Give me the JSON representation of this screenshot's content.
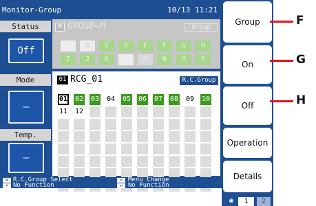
{
  "window": {
    "title": "Monitor-Group",
    "datetime": "10/13 11:21"
  },
  "left": {
    "status_label": "Status",
    "status_value": "Off",
    "mode_label": "Mode",
    "mode_value": "–",
    "temp_label": "Temp.",
    "temp_value": "–"
  },
  "group": {
    "badge": "M",
    "name": "GROUP—M",
    "tag": "Group",
    "cells": [
      {
        "label": "",
        "style": "w"
      },
      {
        "label": "B",
        "style": "w"
      },
      {
        "label": "C",
        "style": "g"
      },
      {
        "label": "D",
        "style": "g"
      },
      {
        "label": "E",
        "style": "g"
      },
      {
        "label": "F",
        "style": "g"
      },
      {
        "label": "G",
        "style": "g"
      },
      {
        "label": "H",
        "style": "g"
      },
      {
        "label": "I",
        "style": "g"
      },
      {
        "label": "J",
        "style": "g"
      },
      {
        "label": "K",
        "style": "g"
      },
      {
        "label": "",
        "style": "w"
      },
      {
        "label": "M",
        "style": "s"
      },
      {
        "label": "N",
        "style": "g"
      },
      {
        "label": "O",
        "style": "g"
      },
      {
        "label": "P",
        "style": "g"
      }
    ]
  },
  "rc_group": {
    "badge": "01",
    "name": "RCG_01",
    "tag": "R.C.Group",
    "row1": [
      {
        "label": "01",
        "style": "sel"
      },
      {
        "label": "02",
        "style": "g"
      },
      {
        "label": "03",
        "style": "g"
      },
      {
        "label": "04",
        "style": "w"
      },
      {
        "label": "05",
        "style": "g"
      },
      {
        "label": "06",
        "style": "g"
      },
      {
        "label": "07",
        "style": "g"
      },
      {
        "label": "08",
        "style": "g"
      },
      {
        "label": "09",
        "style": "w"
      },
      {
        "label": "10",
        "style": "g"
      }
    ],
    "row2": [
      {
        "label": "11",
        "style": "w"
      },
      {
        "label": "12",
        "style": "w"
      }
    ]
  },
  "footer": {
    "left_top_icon": "⇄",
    "left_top": "R.C.Group Select",
    "left_bottom_icon": "✕",
    "left_bottom": "No Function",
    "right_top_icon": "▭",
    "right_top": "Menu Change",
    "right_bottom_icon": "↵",
    "right_bottom": "No Function"
  },
  "sidebar": {
    "group": "Group",
    "on": "On",
    "off": "Off",
    "operation": "Operation",
    "details": "Details",
    "page_icon": "◉",
    "page1": "1",
    "page2": "2"
  },
  "callouts": {
    "f": "F",
    "g": "G",
    "h": "H"
  },
  "colors": {
    "screen_blue": "#1f4f93",
    "active_green": "#3c9a1e",
    "callout_red": "#e3121b"
  }
}
